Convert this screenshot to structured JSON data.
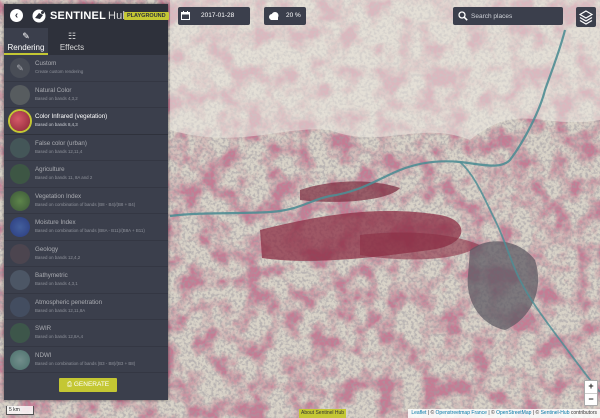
{
  "app": {
    "name": "SENTINEL",
    "sub": "Hub",
    "badge": "PLAYGROUND"
  },
  "tabs": [
    {
      "label": "Rendering"
    },
    {
      "label": "Effects"
    }
  ],
  "layers": [
    {
      "name": "Custom",
      "desc": "Create custom rendering",
      "color": "#55595f"
    },
    {
      "name": "Natural Color",
      "desc": "Based on bands 4,3,2",
      "color": "#6e7470"
    },
    {
      "name": "Color Infrared (vegetation)",
      "desc": "Based on bands 8,4,3",
      "color": "#b03a4a"
    },
    {
      "name": "False color (urban)",
      "desc": "Based on bands 12,11,4",
      "color": "#4d6a62"
    },
    {
      "name": "Agriculture",
      "desc": "Based on bands 11, 8A and 2",
      "color": "#3f6a3f"
    },
    {
      "name": "Vegetation Index",
      "desc": "Based on combination of bands (B8 - B4)/(B8 + B4)",
      "color": "#4f8a3a"
    },
    {
      "name": "Moisture Index",
      "desc": "Based on combination of bands (B8A - B11)/(B8A + B11)",
      "color": "#3355cc"
    },
    {
      "name": "Geology",
      "desc": "Based on bands 12,4,2",
      "color": "#5a4a52"
    },
    {
      "name": "Bathymetric",
      "desc": "Based on bands 4,3,1",
      "color": "#5a6a7a"
    },
    {
      "name": "Atmospheric penetration",
      "desc": "Based on bands 12,11,8A",
      "color": "#4a5a72"
    },
    {
      "name": "SWIR",
      "desc": "Based on bands 12,8A,4",
      "color": "#3f6a4a"
    },
    {
      "name": "NDWI",
      "desc": "Based on combination of bands (B3 - B8)/(B3 + B8)",
      "color": "#7ab0a0"
    }
  ],
  "generate_label": "GENERATE",
  "date": "2017-01-28",
  "cloud": "20 %",
  "search": {
    "placeholder": "Search places"
  },
  "zoom": {
    "in": "+",
    "out": "−"
  },
  "scale": "5 km",
  "about_hub": "About Sentinel Hub",
  "attribution": {
    "leaflet": "Leaflet",
    "a": " | © ",
    "osm_fr": "Openstreetmap France",
    "b": " | © ",
    "osm": "OpenStreetMap",
    "c": " | © ",
    "sentinel": "Sentinel-Hub",
    "d": " contributors"
  },
  "colors": {
    "accent": "#c4c733",
    "panel": "#3b3f4c",
    "panel_dark": "#2e313b"
  }
}
